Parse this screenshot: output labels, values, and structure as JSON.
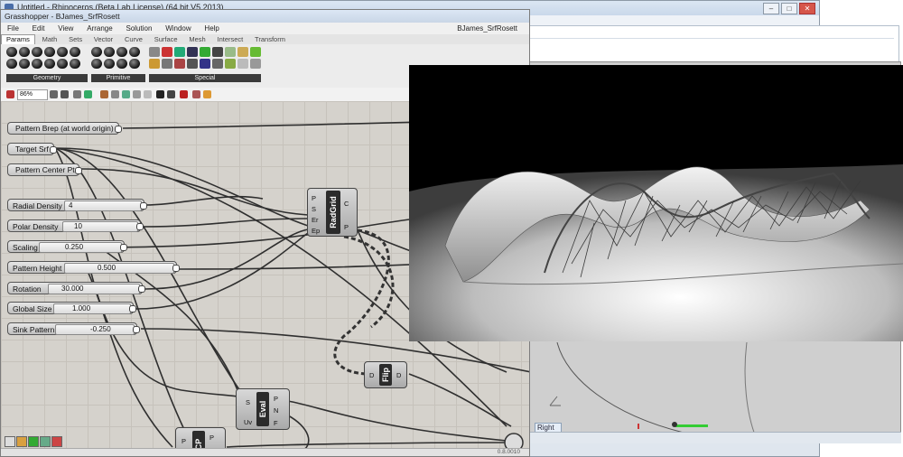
{
  "rhino": {
    "title": "Untitled - Rhinoceros (Beta Lab License) (64 bit V5.2013)",
    "viewport_label": "Right"
  },
  "grasshopper": {
    "title": "Grasshopper - BJames_SrfRosett",
    "document_name": "BJames_SrfRosett",
    "menu": [
      "File",
      "Edit",
      "View",
      "Arrange",
      "Solution",
      "Window",
      "Help"
    ],
    "tabs": [
      "Params",
      "Math",
      "Sets",
      "Vector",
      "Curve",
      "Surface",
      "Mesh",
      "Intersect",
      "Transform"
    ],
    "active_tab": "Params",
    "ribbon_groups": [
      "Geometry",
      "Primitive",
      "Special"
    ],
    "zoom": "86%",
    "version": "0.8.0010"
  },
  "params": [
    {
      "label": "Pattern Brep (at world origin)"
    },
    {
      "label": "Target Srf"
    },
    {
      "label": "Pattern Center Pt"
    }
  ],
  "sliders": [
    {
      "label": "Radial Density",
      "value": "4"
    },
    {
      "label": "Polar Density",
      "value": "10"
    },
    {
      "label": "Scaling",
      "value": "0.250"
    },
    {
      "label": "Pattern Height",
      "value": "0.500"
    },
    {
      "label": "Rotation",
      "value": "30.000"
    },
    {
      "label": "Global Size",
      "value": "1.000"
    },
    {
      "label": "Sink Pattern",
      "value": "-0.250"
    }
  ],
  "components": {
    "radgrid": {
      "name": "RadGrid",
      "inputs": [
        "P",
        "S",
        "Er",
        "Ep"
      ],
      "outputs": [
        "C",
        "P"
      ]
    },
    "flip": {
      "name": "Flip",
      "inputs": [
        "D"
      ],
      "outputs": [
        "D"
      ]
    },
    "eval": {
      "name": "Eval",
      "inputs": [
        "S",
        "Uv"
      ],
      "outputs": [
        "P",
        "N",
        "F"
      ]
    },
    "cp": {
      "name": "CP",
      "inputs": [
        "P"
      ],
      "outputs": [
        "P"
      ]
    }
  },
  "colors": {
    "canvas": "#d5d2cc",
    "component_core": "#2b2b2b",
    "viewport_green": "#33cc33"
  }
}
